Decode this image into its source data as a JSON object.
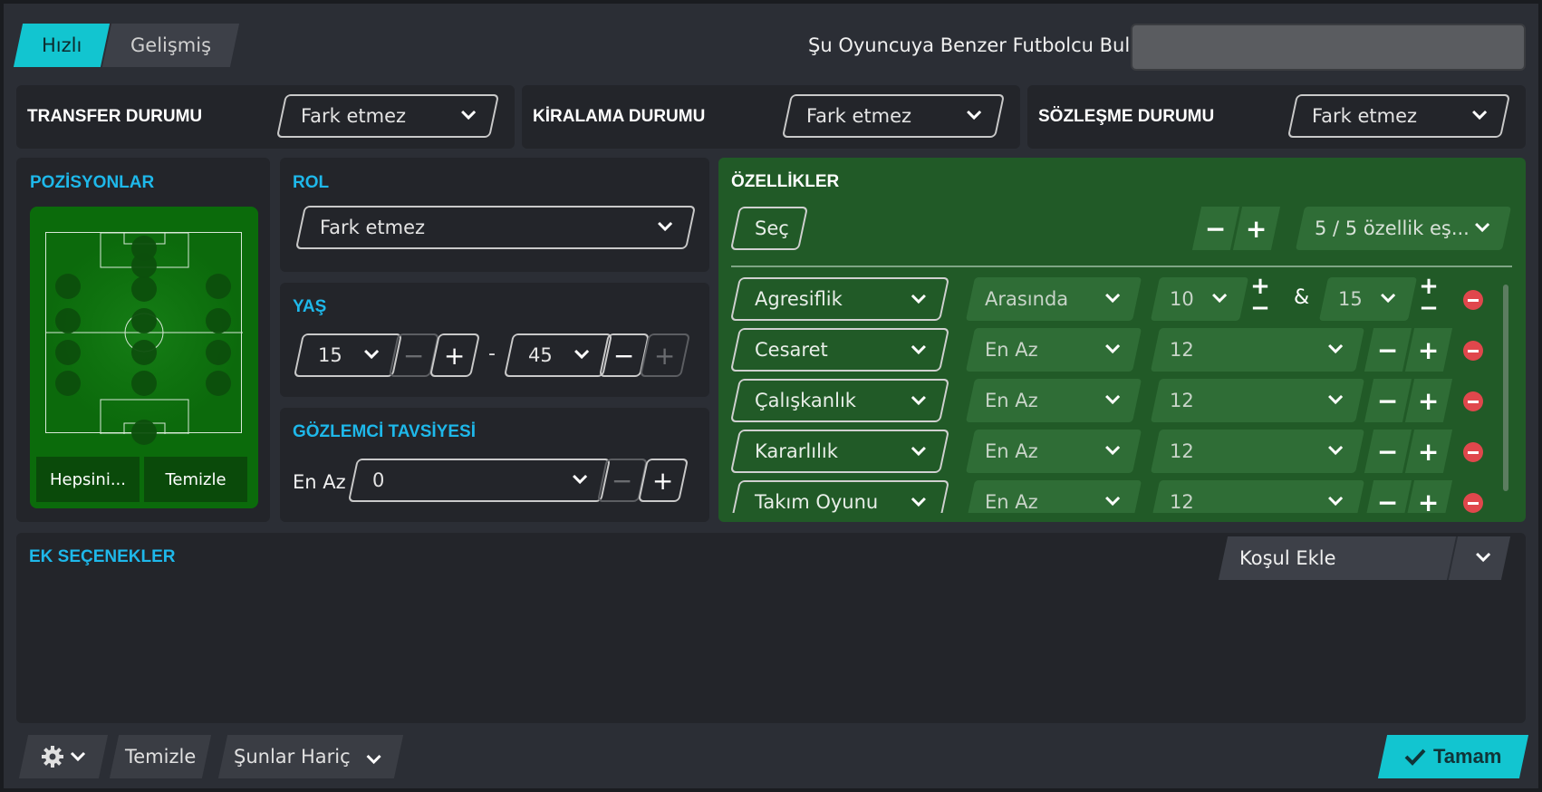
{
  "tabs": {
    "quick": "Hızlı",
    "advanced": "Gelişmiş"
  },
  "find_similar": {
    "label": "Şu Oyuncuya Benzer Futbolcu Bul",
    "value": ""
  },
  "transfer": {
    "title": "TRANSFER DURUMU",
    "value": "Fark etmez"
  },
  "loan": {
    "title": "KİRALAMA DURUMU",
    "value": "Fark etmez"
  },
  "contract": {
    "title": "SÖZLEŞME DURUMU",
    "value": "Fark etmez"
  },
  "positions": {
    "title": "POZİSYONLAR",
    "select_all": "Hepsini...",
    "clear": "Temizle"
  },
  "role": {
    "title": "ROL",
    "value": "Fark etmez"
  },
  "age": {
    "title": "YAŞ",
    "min": "15",
    "max": "45",
    "dash": "-"
  },
  "scout": {
    "title": "GÖZLEMCİ TAVSİYESİ",
    "label": "En Az",
    "value": "0"
  },
  "attributes": {
    "title": "ÖZELLİKLER",
    "select_label": "Seç",
    "match_summary": "5 / 5 özellik eş...",
    "rows": [
      {
        "attr": "Agresiflik",
        "op": "Arasında",
        "v1": "10",
        "amp": "&",
        "v2": "15"
      },
      {
        "attr": "Cesaret",
        "op": "En Az",
        "v1": "12"
      },
      {
        "attr": "Çalışkanlık",
        "op": "En Az",
        "v1": "12"
      },
      {
        "attr": "Kararlılık",
        "op": "En Az",
        "v1": "12"
      },
      {
        "attr": "Takım Oyunu",
        "op": "En Az",
        "v1": "12"
      }
    ]
  },
  "extras": {
    "title": "EK SEÇENEKLER",
    "add_condition": "Koşul Ekle"
  },
  "bottom": {
    "clear": "Temizle",
    "except": "Şunlar Hariç",
    "ok": "Tamam"
  },
  "colors": {
    "accent": "#12c5d0",
    "section": "#1eb8ea",
    "attr_bg": "#215a27",
    "pitch": "#0b6b0b",
    "remove": "#e0474c"
  },
  "icons": {
    "settings": "gear-icon",
    "ok": "check-icon",
    "remove": "minus-circle-icon"
  }
}
